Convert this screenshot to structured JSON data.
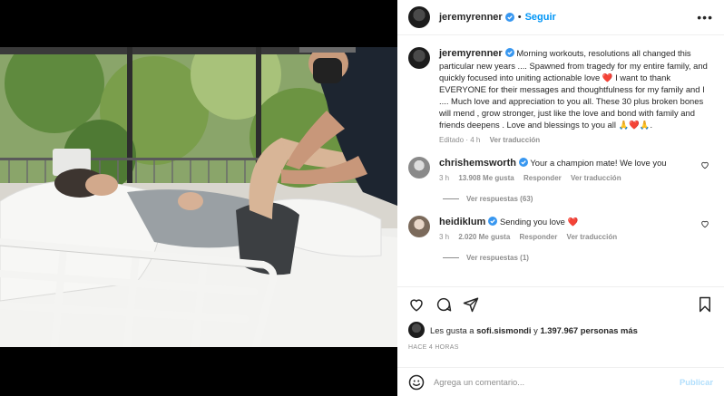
{
  "post": {
    "username": "jeremyrenner",
    "follow_label": "Seguir",
    "more_label": "•••",
    "caption": "Morning workouts, resolutions all changed this particular new years .... Spawned from tragedy for my entire family, and quickly focused into uniting actionable love ❤️ I want to thank EVERYONE for their messages and thoughtfulness for my family and I .... Much love and appreciation to you all. These 30 plus broken bones will mend , grow stronger, just like the love and bond with family and friends deepens . Love and blessings to you all 🙏❤️🙏.",
    "caption_edited": "Editado · 4 h",
    "caption_translate": "Ver traducción"
  },
  "comments": [
    {
      "username": "chrishemsworth",
      "text": "Your a champion mate! We love you",
      "time": "3 h",
      "likes": "13.908 Me gusta",
      "reply": "Responder",
      "translate": "Ver traducción",
      "view_replies": "Ver respuestas (63)"
    },
    {
      "username": "heidiklum",
      "text": "Sending you love ❤️",
      "time": "3 h",
      "likes": "2.020 Me gusta",
      "reply": "Responder",
      "translate": "Ver traducción",
      "view_replies": "Ver respuestas (1)"
    }
  ],
  "actions": {
    "likes_prefix": "Les gusta a",
    "likes_user": "sofi.sismondi",
    "likes_suffix": "y",
    "likes_count": "1.397.967 personas más",
    "timestamp": "HACE 4 HORAS"
  },
  "add_comment": {
    "placeholder": "Agrega un comentario...",
    "publish_label": "Publicar"
  },
  "colors": {
    "accent": "#0095f6",
    "heart": "#ed4956",
    "verified": "#3897f0"
  },
  "icons": [
    "heart-icon",
    "comment-icon",
    "share-icon",
    "bookmark-icon",
    "smile-icon",
    "verified-icon",
    "more-icon"
  ]
}
